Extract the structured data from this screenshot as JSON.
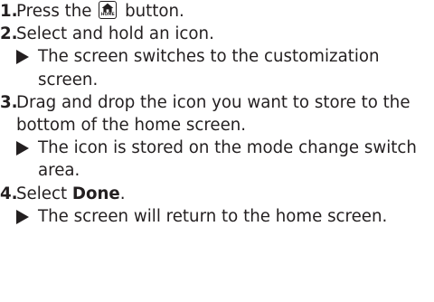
{
  "steps": [
    {
      "number": "1.",
      "text_before": "Press the ",
      "button_icon": "home-icon",
      "button_label": "HOME",
      "text_after": " button."
    },
    {
      "number": "2.",
      "text": "Select and hold an icon.",
      "result": "The screen switches to the customization screen."
    },
    {
      "number": "3.",
      "text": "Drag and drop the icon you want to store to the bottom of the home screen.",
      "result": "The icon is stored on the mode change switch area."
    },
    {
      "number": "4.",
      "text_before": "Select ",
      "bold": "Done",
      "text_after": ".",
      "result": "The screen will return to the home screen."
    }
  ],
  "colors": {
    "text": "#231f20",
    "background": "#ffffff"
  }
}
